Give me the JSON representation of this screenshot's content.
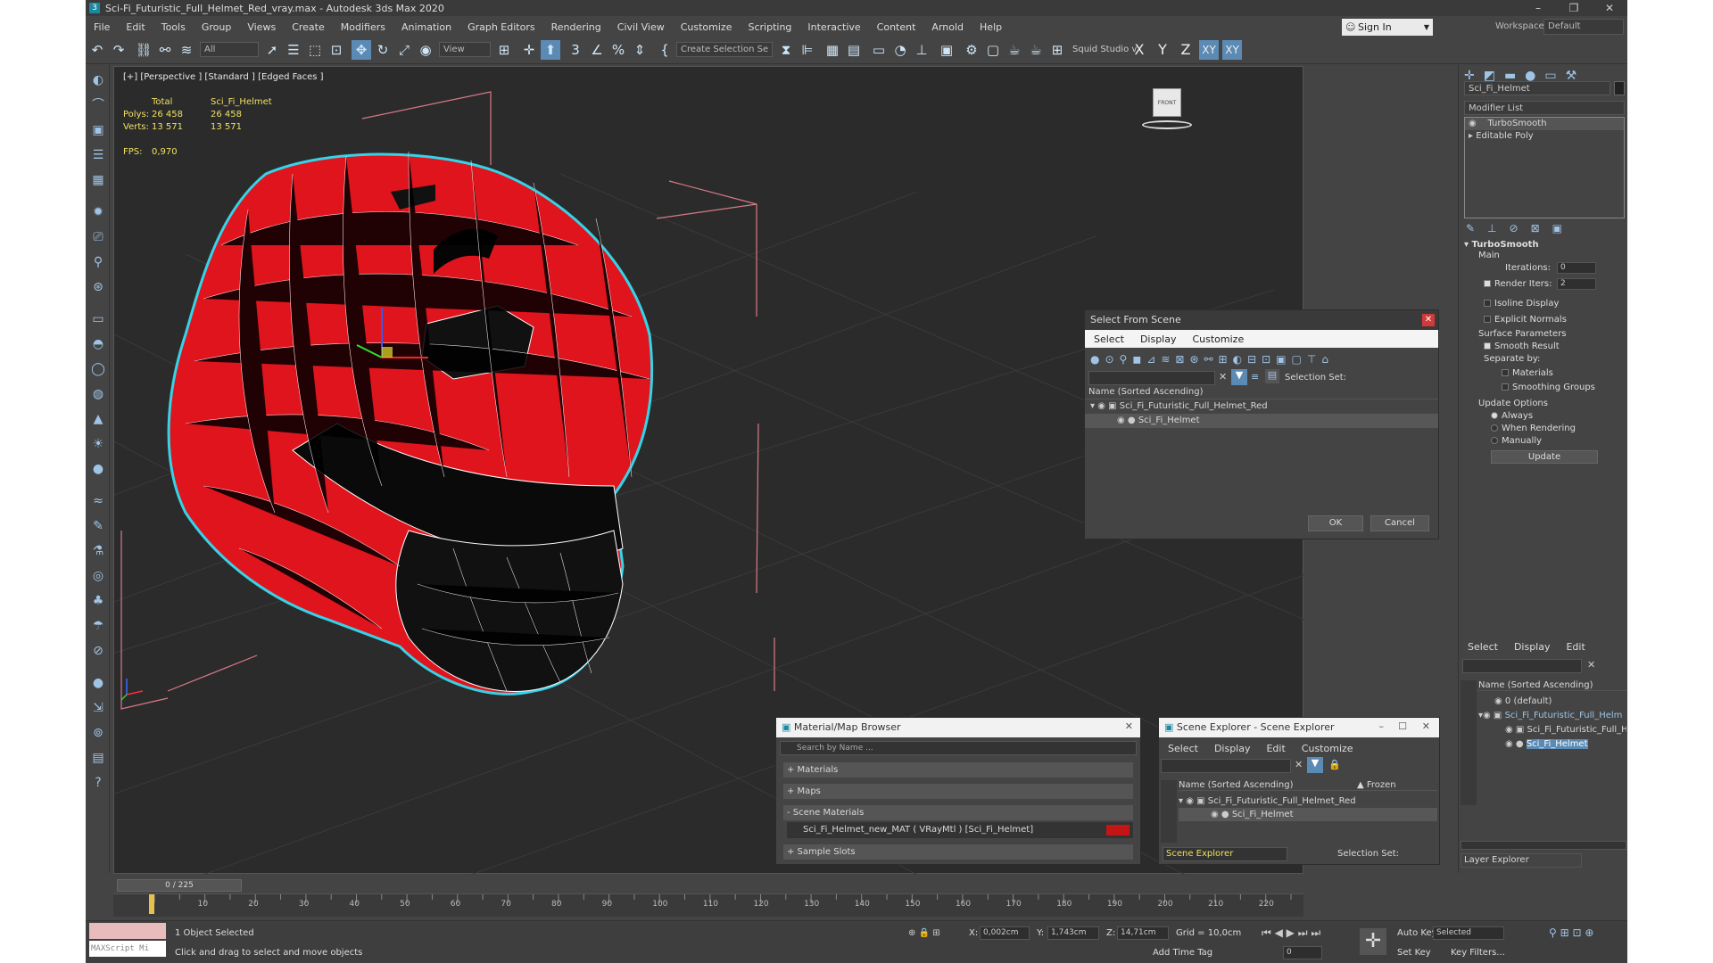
{
  "window": {
    "title": "Sci-Fi_Futuristic_Full_Helmet_Red_vray.max - Autodesk 3ds Max 2020",
    "controls": [
      "–",
      "❐",
      "✕"
    ]
  },
  "menu": [
    "File",
    "Edit",
    "Tools",
    "Group",
    "Views",
    "Create",
    "Modifiers",
    "Animation",
    "Graph Editors",
    "Rendering",
    "Civil View",
    "Customize",
    "Scripting",
    "Interactive",
    "Content",
    "Arnold",
    "Help"
  ],
  "signin": "Sign In",
  "workspaces": {
    "label": "Workspaces:",
    "value": "Default"
  },
  "toolbar": {
    "filter": "All",
    "view": "View",
    "create_selection": "Create Selection Se",
    "squid": "Squid Studio v",
    "axes": [
      "X",
      "Y",
      "Z",
      "XY",
      "XY"
    ]
  },
  "viewport": {
    "label": "[+] [Perspective ] [Standard ] [Edged Faces ]",
    "stats": {
      "col_total": "Total",
      "col_obj": "Sci_Fi_Helmet",
      "polys_label": "Polys:",
      "polys_total": "26 458",
      "polys_obj": "26 458",
      "verts_label": "Verts:",
      "verts_total": "13 571",
      "verts_obj": "13 571",
      "fps_label": "FPS:",
      "fps_value": "0,970"
    },
    "cube_label": "FRONT"
  },
  "select_from_scene": {
    "title": "Select From Scene",
    "tabs": [
      "Select",
      "Display",
      "Customize"
    ],
    "selection_set": "Selection Set:",
    "column": "Name (Sorted Ascending)",
    "items": [
      "Sci_Fi_Futuristic_Full_Helmet_Red",
      "Sci_Fi_Helmet"
    ],
    "ok": "OK",
    "cancel": "Cancel"
  },
  "material_browser": {
    "title": "Material/Map Browser",
    "search": "Search by Name ...",
    "groups": [
      "+ Materials",
      "+ Maps",
      "- Scene Materials",
      "+ Sample Slots"
    ],
    "scene_material": "Sci_Fi_Helmet_new_MAT ( VRayMtl ) [Sci_Fi_Helmet]"
  },
  "scene_explorer": {
    "title": "Scene Explorer - Scene Explorer",
    "tabs": [
      "Select",
      "Display",
      "Edit",
      "Customize"
    ],
    "column": "Name (Sorted Ascending)",
    "frozen": "▲ Frozen",
    "items": [
      "Sci_Fi_Futuristic_Full_Helmet_Red",
      "Sci_Fi_Helmet"
    ],
    "footer_name": "Scene Explorer",
    "footer_set": "Selection Set:"
  },
  "command_panel": {
    "object_name": "Sci_Fi_Helmet",
    "modifier_list": "Modifier List",
    "stack": [
      "TurboSmooth",
      "Editable Poly"
    ],
    "turbosmooth": {
      "title": "TurboSmooth",
      "main": "Main",
      "iterations_label": "Iterations:",
      "iterations": "0",
      "render_iters_label": "Render Iters:",
      "render_iters": "2",
      "isoline": "Isoline Display",
      "explicit": "Explicit Normals",
      "surface": "Surface Parameters",
      "smooth_result": "Smooth Result",
      "separate": "Separate by:",
      "materials": "Materials",
      "smoothing": "Smoothing Groups",
      "update_options": "Update Options",
      "always": "Always",
      "when_rendering": "When Rendering",
      "manually": "Manually",
      "update": "Update"
    }
  },
  "layer_explorer": {
    "tabs": [
      "Select",
      "Display",
      "Edit"
    ],
    "column": "Name (Sorted Ascending)",
    "items": [
      "0 (default)",
      "Sci_Fi_Futuristic_Full_Helm",
      "Sci_Fi_Futuristic_Full_H",
      "Sci_Fi_Helmet"
    ],
    "footer": "Layer Explorer"
  },
  "timeline": {
    "frame": "0 / 225",
    "ticks": [
      "10",
      "20",
      "30",
      "40",
      "50",
      "60",
      "70",
      "80",
      "90",
      "100",
      "110",
      "120",
      "130",
      "140",
      "150",
      "160",
      "170",
      "180",
      "190",
      "200",
      "210",
      "220"
    ]
  },
  "status": {
    "maxscript": "MAXScript Mi",
    "selected": "1 Object Selected",
    "hint": "Click and drag to select and move objects",
    "x_label": "X:",
    "x": "0,002cm",
    "y_label": "Y:",
    "y": "1,743cm",
    "z_label": "Z:",
    "z": "14,71cm",
    "grid": "Grid = 10,0cm",
    "add_time_tag": "Add Time Tag",
    "auto_key": "Auto Key",
    "selected_dd": "Selected",
    "set_key": "Set Key",
    "key_filters": "Key Filters...",
    "frame": "0"
  },
  "colors": {
    "accent": "#5b8ab5",
    "helmet": "#e0141c",
    "selection": "#36d3e8"
  }
}
